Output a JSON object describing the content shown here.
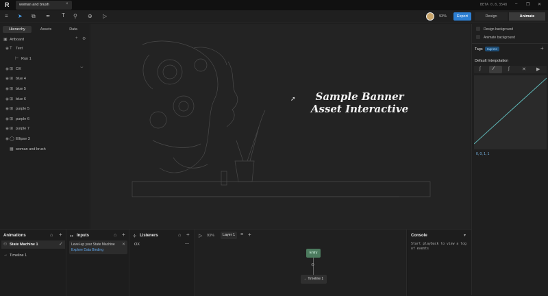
{
  "titlebar": {
    "logo": "R",
    "tab_label": "woman and brush",
    "tab_close": "×",
    "beta": "BETA 0.8.3548",
    "win_min": "–",
    "win_max": "❐",
    "win_close": "✕"
  },
  "toolbar": {
    "zoom": "93%",
    "export_label": "Export",
    "design_tab": "Design",
    "animate_tab": "Animate",
    "accent": "#2d7fd3"
  },
  "hierarchy": {
    "tabs": [
      "Hierarchy",
      "Assets",
      "Data"
    ],
    "artboard_label": "Artboard",
    "items": [
      {
        "label": "Text",
        "icon": "text-icon"
      },
      {
        "label": "Run 1",
        "icon": "run-icon"
      },
      {
        "label": "OX",
        "icon": "group-icon"
      },
      {
        "label": "blue 4",
        "icon": "group-icon"
      },
      {
        "label": "blue 5",
        "icon": "group-icon"
      },
      {
        "label": "blue 6",
        "icon": "group-icon"
      },
      {
        "label": "purple 5",
        "icon": "group-icon"
      },
      {
        "label": "purple 6",
        "icon": "group-icon"
      },
      {
        "label": "purple 7",
        "icon": "group-icon"
      },
      {
        "label": "Ellipse 3",
        "icon": "ellipse-icon"
      },
      {
        "label": "woman and brush",
        "icon": "image-icon"
      }
    ]
  },
  "canvas": {
    "banner_line1": "Sample Banner",
    "banner_line2": "Asset Interactive"
  },
  "right_panel": {
    "design_background": "Design background",
    "animate_background": "Animate background",
    "tags_label": "Tags",
    "tag": "tagnete",
    "add": "+",
    "interp_label": "Default Interpolation",
    "curve_values": "0, 0, 1, 1"
  },
  "animations": {
    "title": "Animations",
    "state_machine": "State Machine 1",
    "timeline": "Timeline 1"
  },
  "inputs": {
    "title": "Inputs",
    "banner_text": "Level-up your State Machine",
    "banner_link": "Explore Data Binding"
  },
  "listeners": {
    "title": "Listeners",
    "item": "OX",
    "item_action": "—"
  },
  "graph": {
    "zoom": "93%",
    "layer": "Layer 1",
    "entry": "Entry",
    "timeline": "Timeline 1"
  },
  "console": {
    "title": "Console",
    "message": "Start playback to view a log of events"
  }
}
